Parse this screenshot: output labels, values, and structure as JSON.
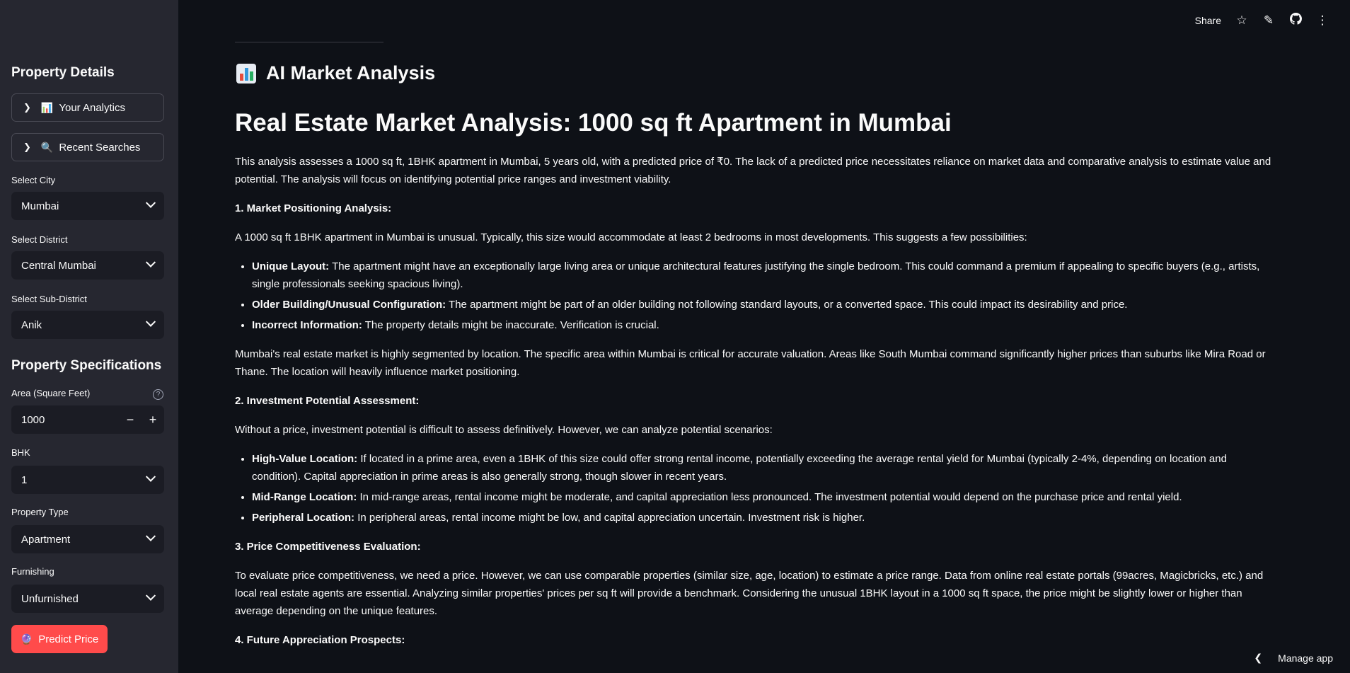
{
  "sidebar": {
    "heading_property_details": "Property Details",
    "expander_analytics": {
      "emoji": "📊",
      "label": "Your Analytics"
    },
    "expander_recent": {
      "emoji": "🔍",
      "label": "Recent Searches"
    },
    "city": {
      "label": "Select City",
      "value": "Mumbai"
    },
    "district": {
      "label": "Select District",
      "value": "Central Mumbai"
    },
    "subdistrict": {
      "label": "Select Sub-District",
      "value": "Anik"
    },
    "heading_specs": "Property Specifications",
    "area": {
      "label": "Area (Square Feet)",
      "value": "1000",
      "minus": "−",
      "plus": "+",
      "help": "?"
    },
    "bhk": {
      "label": "BHK",
      "value": "1"
    },
    "property_type": {
      "label": "Property Type",
      "value": "Apartment"
    },
    "furnishing": {
      "label": "Furnishing",
      "value": "Unfurnished"
    },
    "predict_button": {
      "emoji": "🔮",
      "label": "Predict Price"
    }
  },
  "topbar": {
    "share": "Share",
    "icons": [
      "star-icon",
      "edit-icon",
      "github-icon",
      "more-icon"
    ]
  },
  "main": {
    "subheader": "AI Market Analysis",
    "title": "Real Estate Market Analysis: 1000 sq ft Apartment in Mumbai",
    "intro": "This analysis assesses a 1000 sq ft, 1BHK apartment in Mumbai, 5 years old, with a predicted price of ₹0. The lack of a predicted price necessitates reliance on market data and comparative analysis to estimate value and potential. The analysis will focus on identifying potential price ranges and investment viability.",
    "s1_title": "1. Market Positioning Analysis:",
    "s1_p1": "A 1000 sq ft 1BHK apartment in Mumbai is unusual. Typically, this size would accommodate at least 2 bedrooms in most developments. This suggests a few possibilities:",
    "s1_items": [
      {
        "bold": "Unique Layout:",
        "text": " The apartment might have an exceptionally large living area or unique architectural features justifying the single bedroom. This could command a premium if appealing to specific buyers (e.g., artists, single professionals seeking spacious living)."
      },
      {
        "bold": "Older Building/Unusual Configuration:",
        "text": " The apartment might be part of an older building not following standard layouts, or a converted space. This could impact its desirability and price."
      },
      {
        "bold": "Incorrect Information:",
        "text": " The property details might be inaccurate. Verification is crucial."
      }
    ],
    "s1_p2": "Mumbai's real estate market is highly segmented by location. The specific area within Mumbai is critical for accurate valuation. Areas like South Mumbai command significantly higher prices than suburbs like Mira Road or Thane. The location will heavily influence market positioning.",
    "s2_title": "2. Investment Potential Assessment:",
    "s2_p1": "Without a price, investment potential is difficult to assess definitively. However, we can analyze potential scenarios:",
    "s2_items": [
      {
        "bold": "High-Value Location:",
        "text": " If located in a prime area, even a 1BHK of this size could offer strong rental income, potentially exceeding the average rental yield for Mumbai (typically 2-4%, depending on location and condition). Capital appreciation in prime areas is also generally strong, though slower in recent years."
      },
      {
        "bold": "Mid-Range Location:",
        "text": " In mid-range areas, rental income might be moderate, and capital appreciation less pronounced. The investment potential would depend on the purchase price and rental yield."
      },
      {
        "bold": "Peripheral Location:",
        "text": " In peripheral areas, rental income might be low, and capital appreciation uncertain. Investment risk is higher."
      }
    ],
    "s3_title": "3. Price Competitiveness Evaluation:",
    "s3_p1": "To evaluate price competitiveness, we need a price. However, we can use comparable properties (similar size, age, location) to estimate a price range. Data from online real estate portals (99acres, Magicbricks, etc.) and local real estate agents are essential. Analyzing similar properties' prices per sq ft will provide a benchmark. Considering the unusual 1BHK layout in a 1000 sq ft space, the price might be slightly lower or higher than average depending on the unique features.",
    "s4_title": "4. Future Appreciation Prospects:"
  },
  "manage_app": "Manage app"
}
